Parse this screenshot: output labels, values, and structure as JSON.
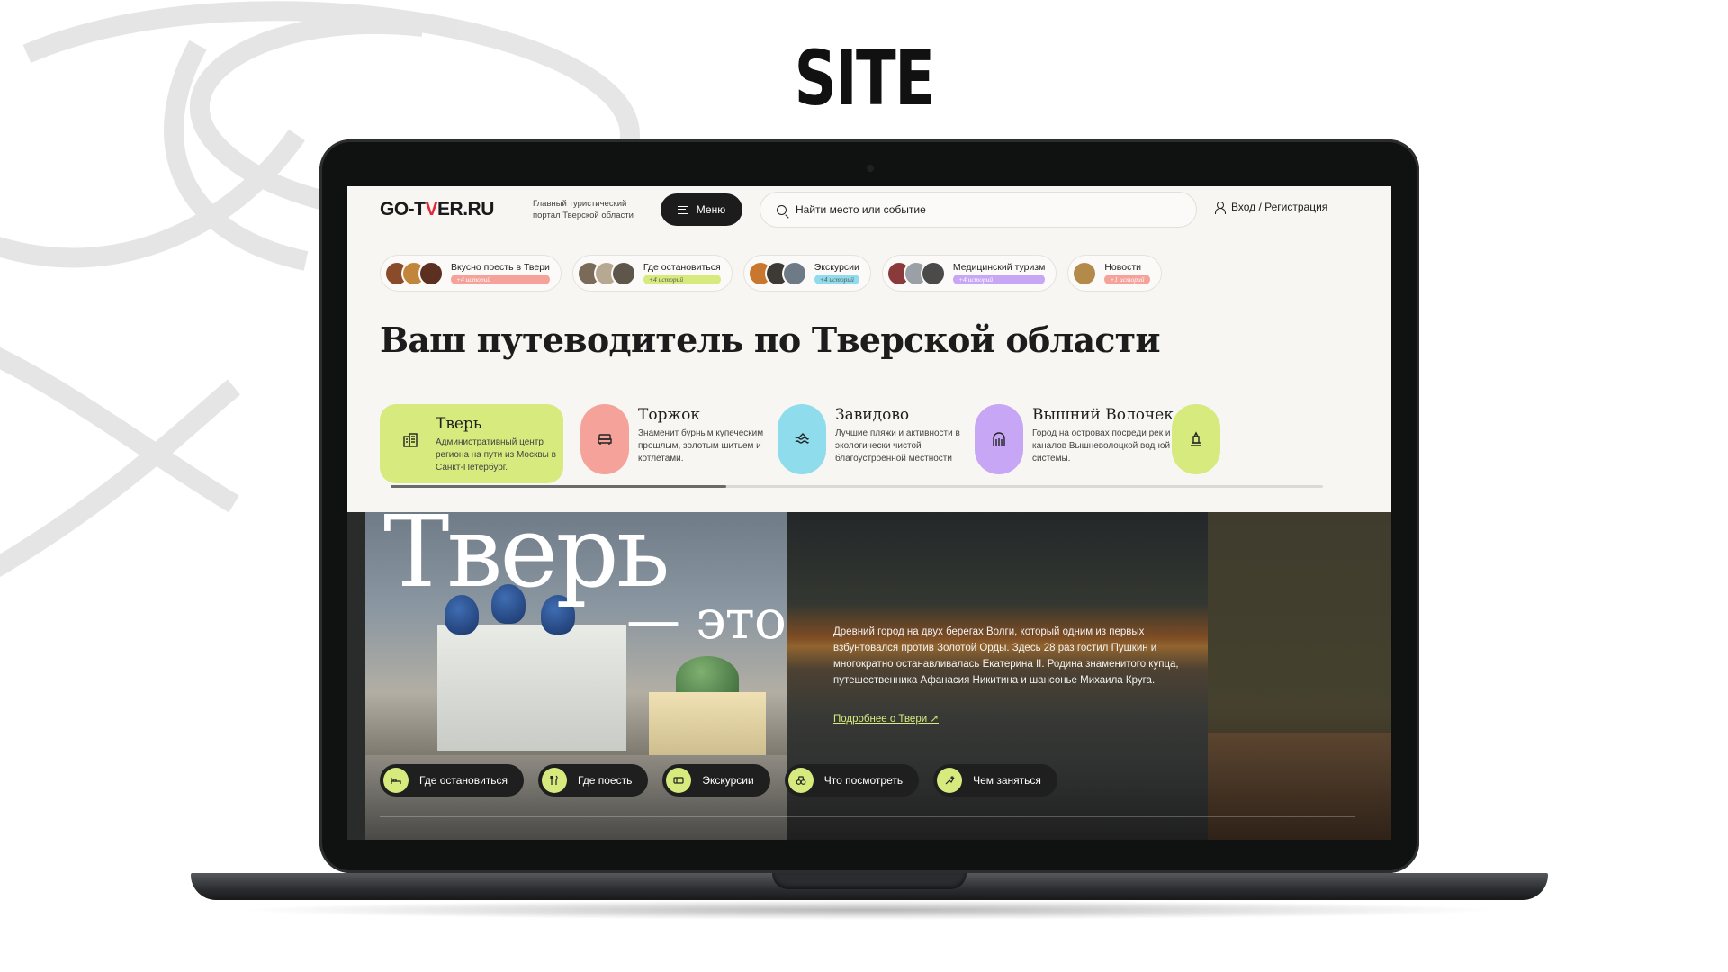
{
  "slide": {
    "title": "SITE"
  },
  "header": {
    "logo": {
      "part1": "GO-T",
      "part2": "V",
      "part3": "ER.RU"
    },
    "tagline": "Главный туристический портал Тверской области",
    "menu_label": "Меню",
    "search_placeholder": "Найти место или событие",
    "login_label": "Вход / Регистрация"
  },
  "categories": [
    {
      "label": "Вкусно поесть в Твери",
      "count": "+4 историй",
      "badge_color": "#f5a29a",
      "thumb_colors": [
        "#8a4b2a",
        "#c2853c",
        "#5b3020"
      ]
    },
    {
      "label": "Где остановиться",
      "count": "+4 историй",
      "badge_color": "#d6ea7d",
      "thumb_colors": [
        "#7a6a58",
        "#b7a891",
        "#5f564b"
      ]
    },
    {
      "label": "Экскурсии",
      "count": "+4 историй",
      "badge_color": "#8fdcec",
      "thumb_colors": [
        "#c9772e",
        "#3d3a36",
        "#6e7a85"
      ]
    },
    {
      "label": "Медицинский туризм",
      "count": "+4 историй",
      "badge_color": "#c6a6f5",
      "thumb_colors": [
        "#8a3a3a",
        "#9aa0a6",
        "#4a4a4a"
      ]
    },
    {
      "label": "Новости",
      "count": "+1 историй",
      "badge_color": "#f5a29a",
      "thumb_colors": [
        "#b48a4a"
      ]
    }
  ],
  "headline": "Ваш путеводитель по Тверской области",
  "cities": [
    {
      "name": "Тверь",
      "desc": "Административный центр региона на пути из Москвы в Санкт-Петербург.",
      "icon": "buildings-icon",
      "color": "#d6ea7d"
    },
    {
      "name": "Торжок",
      "desc": "Знаменит бурным купеческим прошлым, золотым шитьем и котлетами.",
      "icon": "sofa-icon",
      "color": "#f5a29a"
    },
    {
      "name": "Завидово",
      "desc": "Лучшие пляжи и активности в экологически чистой благоустроенной местности",
      "icon": "waves-icon",
      "color": "#8fdcec"
    },
    {
      "name": "Вышний Волочек",
      "desc": "Город на островах посреди рек и каналов Вышневолоцкой водной системы.",
      "icon": "gate-icon",
      "color": "#c6a6f5"
    },
    {
      "name": "",
      "desc": "",
      "icon": "monument-icon",
      "color": "#d6ea7d"
    }
  ],
  "city_scroll_progress": 0.36,
  "hero": {
    "title": "Тверь",
    "subtitle": "— это",
    "text": "Древний город на двух берегах Волги, который одним из первых взбунтовался против Золотой Орды. Здесь 28 раз гостил Пушкин и многократно останавливалась Екатерина II. Родина знаменитого купца, путешественника Афанасия Никитина и шансонье Михаила Круга.",
    "link": "Подробнее о Твери ↗",
    "buttons": [
      {
        "label": "Где остановиться",
        "icon": "bed-icon"
      },
      {
        "label": "Где поесть",
        "icon": "fork-knife-icon"
      },
      {
        "label": "Экскурсии",
        "icon": "ticket-icon"
      },
      {
        "label": "Что посмотреть",
        "icon": "binoculars-icon"
      },
      {
        "label": "Чем заняться",
        "icon": "activity-icon"
      }
    ]
  }
}
